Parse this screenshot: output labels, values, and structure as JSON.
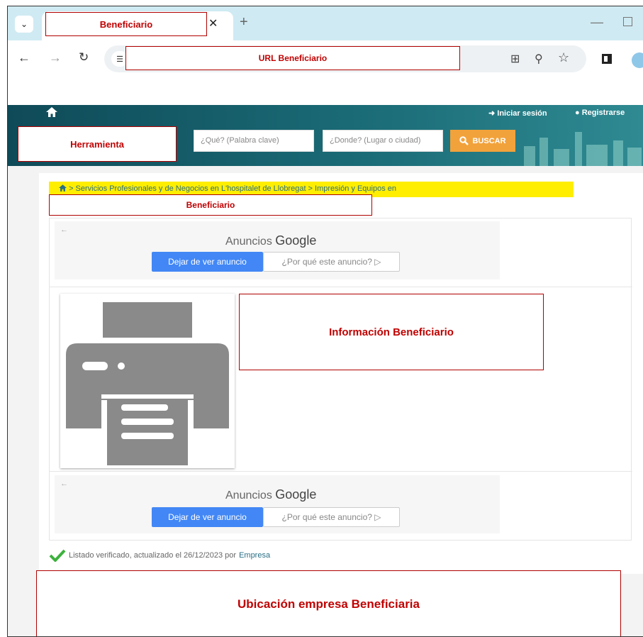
{
  "browser": {
    "tab_label": "Beneficiario",
    "url_label": "URL Beneficiario"
  },
  "site": {
    "header": {
      "login_label": "Iniciar sesión",
      "register_label": "Registrarse",
      "tool_label": "Herramienta",
      "search_placeholder": "¿Qué? (Palabra clave)",
      "location_placeholder": "¿Donde? (Lugar o ciudad)",
      "search_button": "BUSCAR"
    },
    "breadcrumb": "> Servicios Profesionales y de Negocios en L'hospitalet de Llobregat > Impresión y Equipos en",
    "business_label": "Beneficiario",
    "ads": [
      {
        "title_prefix": "Anuncios",
        "title_brand": "Google",
        "stop_label": "Dejar de ver anuncio",
        "why_label": "¿Por qué este anuncio? ▷"
      },
      {
        "title_prefix": "Anuncios",
        "title_brand": "Google",
        "stop_label": "Dejar de ver anuncio",
        "why_label": "¿Por qué este anuncio? ▷"
      }
    ],
    "info_label": "Información Beneficiario",
    "verified": {
      "text": "Listado verificado, actualizado el 26/12/2023 por",
      "link": "Empresa"
    },
    "location_label": "Ubicación empresa Beneficiaria"
  },
  "colors": {
    "header_bg": "#1a6b76",
    "search_button": "#f2a23b",
    "annotation_red": "#c00000",
    "highlight_yellow": "#ffee00",
    "ad_button_blue": "#4287f5"
  },
  "icons": [
    "chevron-down-icon",
    "close-icon",
    "plus-icon",
    "back-icon",
    "forward-icon",
    "reload-icon",
    "site-settings-icon",
    "install-icon",
    "zoom-icon",
    "star-icon",
    "sidebar-icon",
    "profile-icon",
    "home-icon",
    "login-icon",
    "user-icon",
    "search-icon",
    "printer-icon",
    "checkmark-icon"
  ]
}
